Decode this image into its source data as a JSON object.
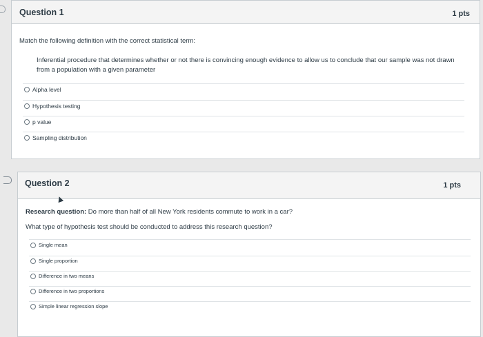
{
  "questions": [
    {
      "title": "Question 1",
      "points": "1 pts",
      "prompt": "Match the following definition with the correct statistical term:",
      "definition": "Inferential procedure that determines whether or not there is convincing enough evidence to allow us to conclude that our sample was not drawn from a population with a given parameter",
      "options": [
        "Alpha level",
        "Hypothesis testing",
        "p value",
        "Sampling distribution"
      ]
    },
    {
      "title": "Question 2",
      "points": "1 pts",
      "research_label": "Research question:",
      "research_text": " Do more than half of all New York residents commute to work in a car?",
      "prompt": "What type of hypothesis test should be conducted to address this research question?",
      "options": [
        "Single mean",
        "Single proportion",
        "Difference in two means",
        "Difference in two proportions",
        "Simple linear regression slope"
      ]
    }
  ]
}
